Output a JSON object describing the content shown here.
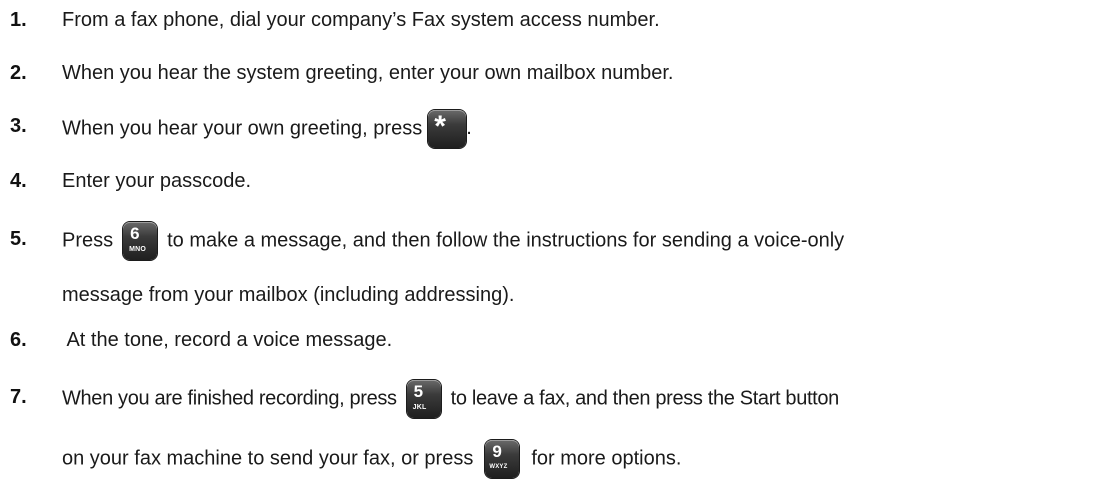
{
  "steps": [
    {
      "number": "1.",
      "text": "From a fax phone, dial your company’s Fax system access number."
    },
    {
      "number": "2.",
      "text": "When you hear the system greeting, enter your own mailbox number."
    },
    {
      "number": "3.",
      "text_before": "When you hear your own greeting, press",
      "key": {
        "symbol": "*"
      },
      "text_after": "."
    },
    {
      "number": "4.",
      "text": "Enter your passcode."
    },
    {
      "number": "5.",
      "text_before": "Press",
      "key": {
        "digit": "6",
        "letters": "MNO"
      },
      "text_after": "to make a message, and then follow the instructions for sending a voice-only",
      "text_line2": "message from your mailbox (including addressing)."
    },
    {
      "number": "6.",
      "text": " At the tone, record a voice message."
    },
    {
      "number": "7.",
      "text_before": "When you are finished recording, press",
      "key": {
        "digit": "5",
        "letters": "JKL"
      },
      "text_after": "to leave a fax, and then press the Start button",
      "line2_before": "on your fax machine to send your fax, or press",
      "key2": {
        "digit": "9",
        "letters": "WXYZ"
      },
      "line2_after": "for more options."
    }
  ]
}
